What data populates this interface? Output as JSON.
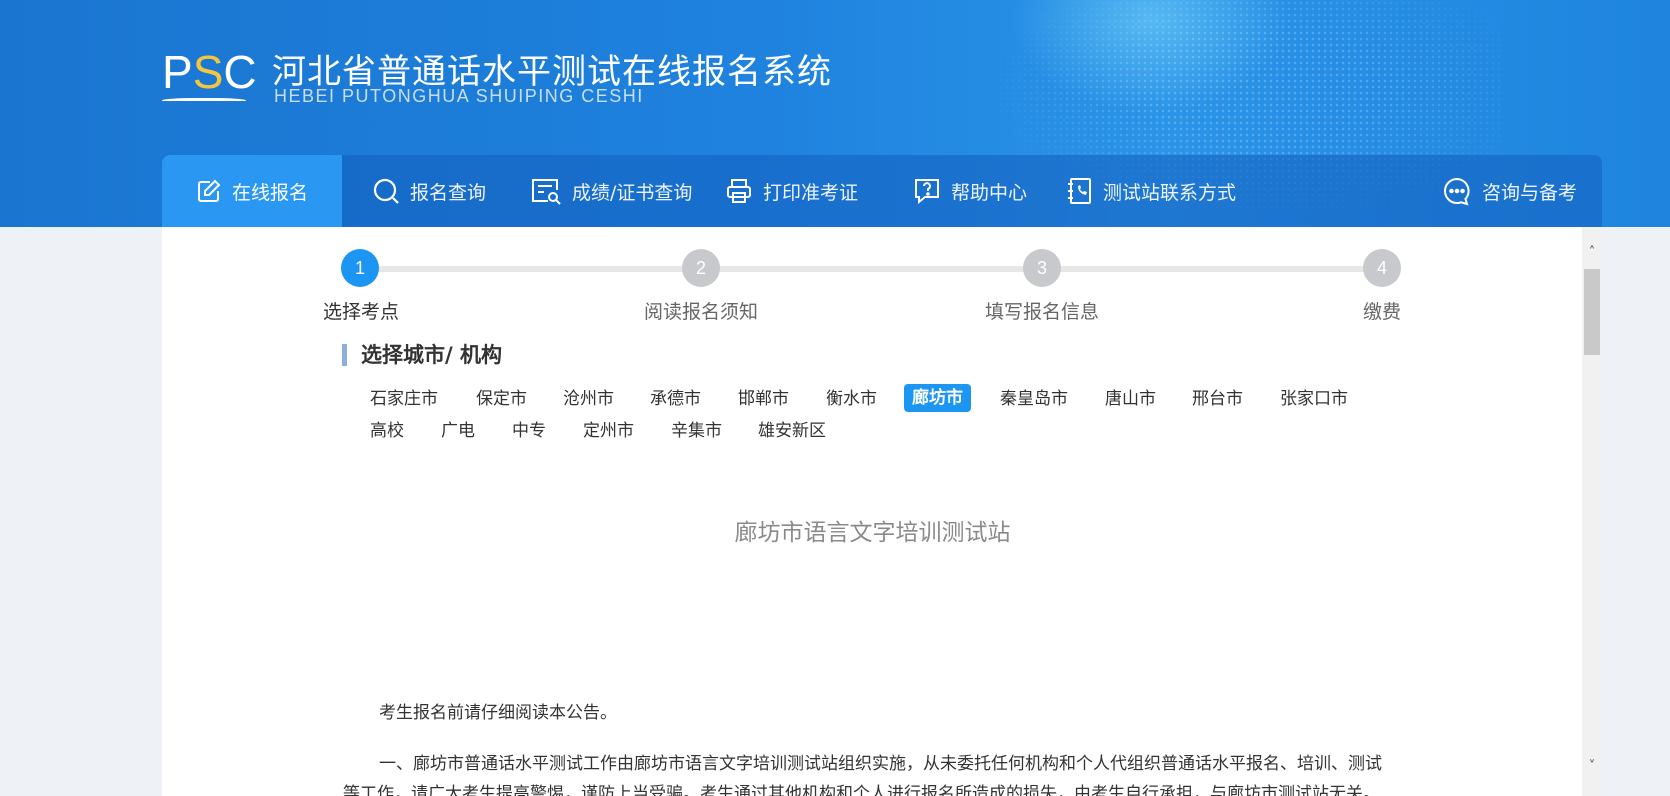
{
  "header": {
    "logo_text_p": "P",
    "logo_text_s": "S",
    "logo_text_c": "C",
    "title": "河北省普通话水平测试在线报名系统",
    "subtitle": "HEBEI PUTONGHUA SHUIPING CESHI"
  },
  "nav": {
    "items": [
      {
        "label": "在线报名",
        "icon": "edit-icon"
      },
      {
        "label": "报名查询",
        "icon": "search-icon"
      },
      {
        "label": "成绩/证书查询",
        "icon": "certificate-search-icon"
      },
      {
        "label": "打印准考证",
        "icon": "printer-icon"
      },
      {
        "label": "帮助中心",
        "icon": "help-icon"
      },
      {
        "label": "测试站联系方式",
        "icon": "phone-book-icon"
      },
      {
        "label": "咨询与备考",
        "icon": "chat-icon"
      }
    ]
  },
  "steps": [
    {
      "number": "1",
      "label": "选择考点"
    },
    {
      "number": "2",
      "label": "阅读报名须知"
    },
    {
      "number": "3",
      "label": "填写报名信息"
    },
    {
      "number": "4",
      "label": "缴费"
    }
  ],
  "section": {
    "title": "选择城市/ 机构"
  },
  "cities": {
    "row1": [
      "石家庄市",
      "保定市",
      "沧州市",
      "承德市",
      "邯郸市",
      "衡水市",
      "廊坊市",
      "秦皇岛市",
      "唐山市",
      "邢台市",
      "张家口市"
    ],
    "row2": [
      "高校",
      "广电",
      "中专",
      "定州市",
      "辛集市",
      "雄安新区"
    ],
    "selected": "廊坊市"
  },
  "content": {
    "org_name": "廊坊市语言文字培训测试站",
    "notice_intro": "考生报名前请仔细阅读本公告。",
    "notice_para1": "一、廊坊市普通话水平测试工作由廊坊市语言文字培训测试站组织实施，从未委托任何机构和个人代组织普通话水平报名、培训、测试等工作，请广大考生提高警惕，谨防上当受骗。考生通过其他机构和个人进行报名所造成的损失，由考生自行承担，与廊坊市测试站无关。"
  },
  "colors": {
    "primary": "#1c96f2",
    "banner": "#1e82de",
    "logo_accent": "#f4c63d"
  }
}
